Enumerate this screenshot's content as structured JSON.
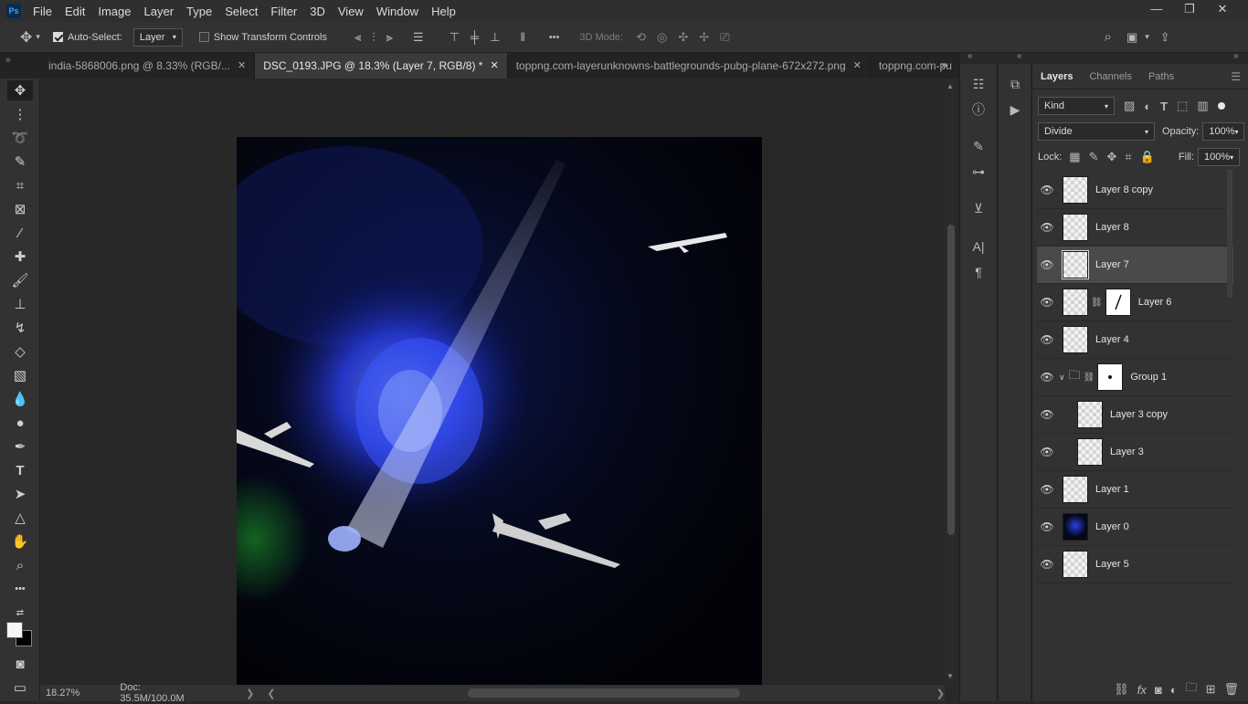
{
  "app": {
    "logo": "Ps"
  },
  "menu": [
    "File",
    "Edit",
    "Image",
    "Layer",
    "Type",
    "Select",
    "Filter",
    "3D",
    "View",
    "Window",
    "Help"
  ],
  "window_controls": {
    "minimize": "—",
    "restore": "❐",
    "close": "✕"
  },
  "options": {
    "auto_select_label": "Auto-Select:",
    "auto_select_value": "Layer",
    "transform_label": "Show Transform Controls",
    "mode_3d_label": "3D Mode:",
    "more": "•••"
  },
  "tabs": [
    {
      "label": "india-5868006.png @ 8.33% (RGB/...",
      "active": false
    },
    {
      "label": "DSC_0193.JPG @ 18.3% (Layer 7, RGB/8) *",
      "active": true
    },
    {
      "label": "toppng.com-layerunknowns-battlegrounds-pubg-plane-672x272.png",
      "active": false
    },
    {
      "label": "toppng.com-pu",
      "active": false
    }
  ],
  "status": {
    "zoom": "18.27%",
    "doc": "Doc: 35.5M/100.0M"
  },
  "layers_panel": {
    "tabs": [
      "Layers",
      "Channels",
      "Paths"
    ],
    "filter_kind": "Kind",
    "blend_mode": "Divide",
    "opacity_label": "Opacity:",
    "opacity_value": "100%",
    "lock_label": "Lock:",
    "fill_label": "Fill:",
    "fill_value": "100%",
    "layers": [
      {
        "name": "Layer 8 copy",
        "indent": 0,
        "type": "pixel"
      },
      {
        "name": "Layer 8",
        "indent": 0,
        "type": "pixel"
      },
      {
        "name": "Layer 7",
        "indent": 0,
        "type": "pixel",
        "selected": true
      },
      {
        "name": "Layer 6",
        "indent": 0,
        "type": "masked"
      },
      {
        "name": "Layer 4",
        "indent": 0,
        "type": "pixel"
      },
      {
        "name": "Group 1",
        "indent": 0,
        "type": "group"
      },
      {
        "name": "Layer 3 copy",
        "indent": 1,
        "type": "pixel"
      },
      {
        "name": "Layer 3",
        "indent": 1,
        "type": "pixel"
      },
      {
        "name": "Layer 1",
        "indent": 0,
        "type": "pixel"
      },
      {
        "name": "Layer 0",
        "indent": 0,
        "type": "image"
      },
      {
        "name": "Layer 5",
        "indent": 0,
        "type": "pixel"
      }
    ]
  }
}
